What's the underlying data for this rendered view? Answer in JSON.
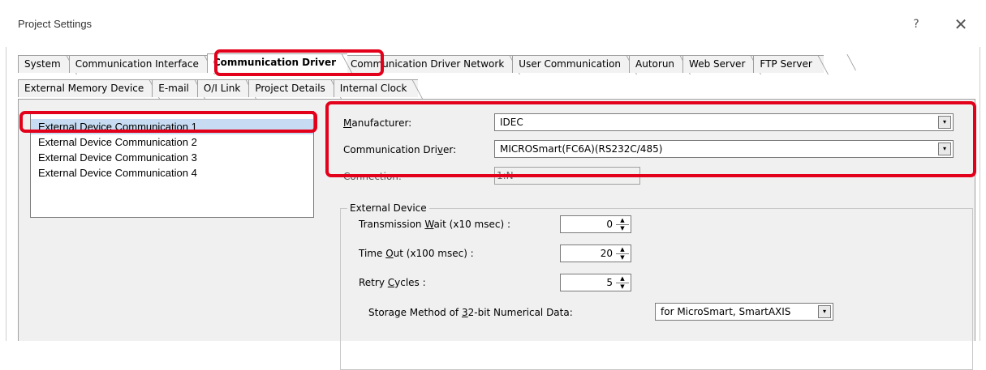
{
  "window": {
    "title": "Project Settings",
    "help_label": "?",
    "close_label": "✕"
  },
  "tabs": {
    "row1": [
      {
        "label": "System"
      },
      {
        "label": "Communication Interface"
      },
      {
        "label": "Communication Driver",
        "active": true
      },
      {
        "label": "Communication Driver Network"
      },
      {
        "label": "User Communication"
      },
      {
        "label": "Autorun"
      },
      {
        "label": "Web Server"
      },
      {
        "label": "FTP Server"
      }
    ],
    "row2": [
      {
        "label": "External Memory Device"
      },
      {
        "label": "E-mail"
      },
      {
        "label": "O/I Link"
      },
      {
        "label": "Project Details"
      },
      {
        "label": "Internal Clock"
      }
    ]
  },
  "device_list": {
    "items": [
      {
        "label": "External Device Communication 1",
        "selected": true
      },
      {
        "label": "External Device Communication 2"
      },
      {
        "label": "External Device Communication 3"
      },
      {
        "label": "External Device Communication 4"
      }
    ]
  },
  "driver": {
    "manufacturer_label_u": "M",
    "manufacturer_label_rest": "anufacturer:",
    "manufacturer_value": "IDEC",
    "driver_label_pre": "Communication Dri",
    "driver_label_u": "v",
    "driver_label_rest": "er:",
    "driver_value": "MICROSmart(FC6A)(RS232C/485)",
    "connection_label": "Connection:",
    "connection_value": "1:N"
  },
  "external_device": {
    "group_title": "External Device",
    "transmission_wait_label_pre": "Transmission ",
    "transmission_wait_label_u": "W",
    "transmission_wait_label_rest": "ait (x10 msec) :",
    "transmission_wait_value": "0",
    "timeout_label_pre": "Time ",
    "timeout_label_u": "O",
    "timeout_label_rest": "ut (x100 msec) :",
    "timeout_value": "20",
    "retry_label_pre": "Retry ",
    "retry_label_u": "C",
    "retry_label_rest": "ycles :",
    "retry_value": "5",
    "storage_label_pre": "Storage Method of ",
    "storage_label_u": "3",
    "storage_label_rest": "2-bit Numerical Data:",
    "storage_value": "for MicroSmart, SmartAXIS"
  },
  "icons": {
    "dropdown": "▾",
    "spin_up": "▲",
    "spin_down": "▼"
  },
  "colors": {
    "highlight": "#e3001b",
    "selection": "#c7dcf2",
    "panel": "#f0f0f0"
  }
}
